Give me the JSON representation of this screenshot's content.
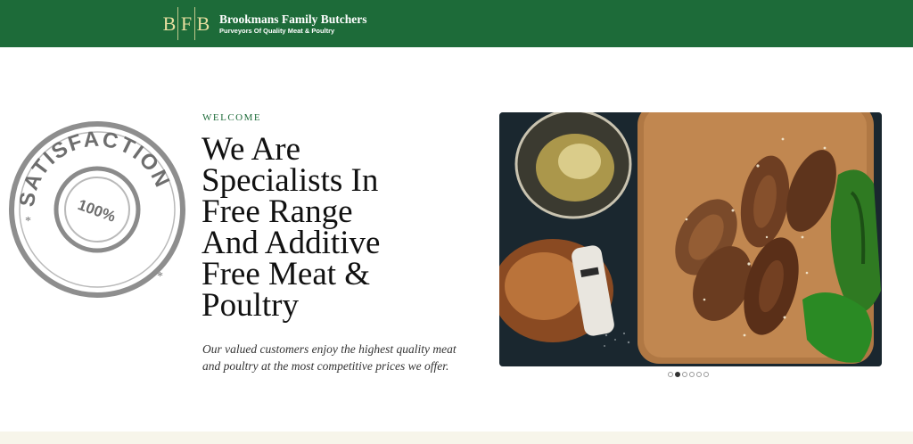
{
  "header": {
    "logo_letters": [
      "B",
      "F",
      "B"
    ],
    "brand_name": "Brookmans Family Butchers",
    "tagline": "Purveyors Of Quality Meat & Poultry"
  },
  "stamp": {
    "text": "SATISFACTION",
    "percent": "100%"
  },
  "hero": {
    "eyebrow": "WELCOME",
    "headline_lines": [
      "We Are",
      "Specialists In",
      "Free Range",
      "And Additive",
      "Free Meat &",
      "Poultry"
    ],
    "subtext": "Our valued customers enjoy the highest quality meat and poultry at the most competitive prices we offer."
  },
  "slider": {
    "slide_count": 6,
    "active_index": 1
  },
  "colors": {
    "brand_green": "#1d6b39",
    "logo_gold": "#e8dfa0",
    "footer_cream": "#f7f5ea"
  }
}
